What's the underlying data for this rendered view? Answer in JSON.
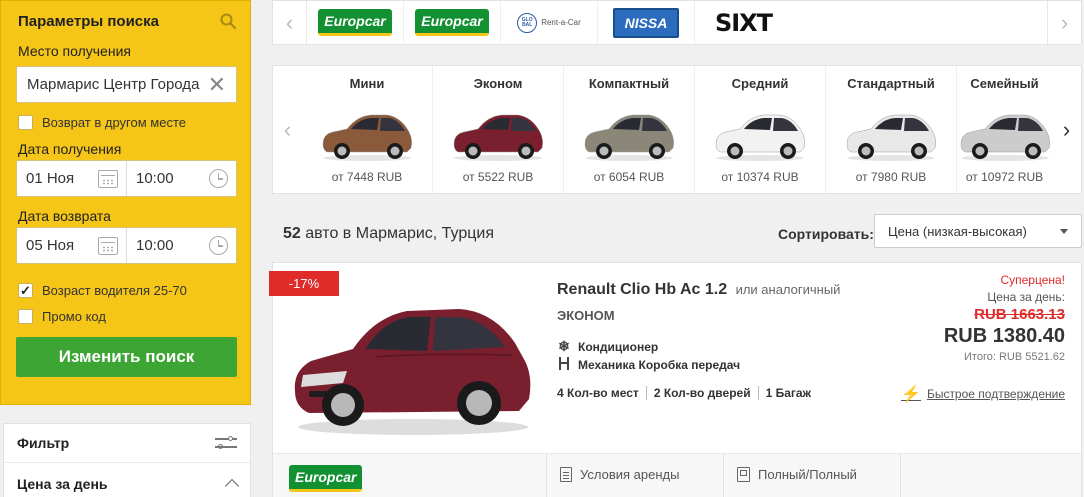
{
  "search": {
    "title": "Параметры поиска",
    "pickup_location_label": "Место получения",
    "pickup_location_value": "Мармарис Центр Города",
    "return_other_label": "Возврат в другом месте",
    "return_other_checked": false,
    "pickup_date_label": "Дата получения",
    "pickup_date": "01 Ноя",
    "pickup_time": "10:00",
    "return_date_label": "Дата возврата",
    "return_date": "05 Ноя",
    "return_time": "10:00",
    "driver_age_label": "Возраст водителя 25-70",
    "driver_age_checked": true,
    "promo_label": "Промо код",
    "promo_checked": false,
    "submit_label": "Изменить поиск",
    "accent_color": "#f5c518",
    "button_color": "#3da534"
  },
  "filter": {
    "title": "Фильтр",
    "section_price": "Цена за день"
  },
  "suppliers": {
    "logos": [
      {
        "name": "Europcar",
        "text": "Europcar"
      },
      {
        "name": "Europcar",
        "text": "Europcar"
      },
      {
        "name": "Global Rent-a-Car",
        "text": "Rent-a-Car",
        "badge": "GLO BAL"
      },
      {
        "name": "Nissa",
        "text": "NISSA"
      },
      {
        "name": "Sixt",
        "text": "SIXT"
      }
    ]
  },
  "categories": [
    {
      "name": "Мини",
      "price": "от 7448 RUB",
      "color": "#8a5a3a"
    },
    {
      "name": "Эконом",
      "price": "от 5522 RUB",
      "color": "#7a1f2e"
    },
    {
      "name": "Компактный",
      "price": "от 6054 RUB",
      "color": "#8a8778"
    },
    {
      "name": "Средний",
      "price": "от 10374 RUB",
      "color": "#f2f2f2"
    },
    {
      "name": "Стандартный",
      "price": "от 7980 RUB",
      "color": "#e8e8e8"
    },
    {
      "name": "Семейный",
      "price": "от 10972 RUB",
      "color": "#cccccc"
    }
  ],
  "results": {
    "count": "52",
    "count_text": "авто в Мармарис, Турция",
    "sort_label": "Сортировать:",
    "sort_value": "Цена (низкая-высокая)"
  },
  "car": {
    "discount": "-17%",
    "model": "Renault Clio Hb Ac 1.2",
    "similar": "или аналогичный",
    "class": "ЭКОНОМ",
    "features": [
      "Кондиционер",
      "Механика Коробка передач"
    ],
    "seats": "4 Кол-во мест",
    "doors": "2 Кол-во дверей",
    "bags": "1 Багаж",
    "super_deal": "Суперцена!",
    "per_day_label": "Цена за день:",
    "old_price": "RUB 1663.13",
    "price": "RUB 1380.40",
    "total": "Итого: RUB 5521.62",
    "fast_confirm": "Быстрое подтверждение",
    "supplier": "Europcar",
    "rental_terms": "Условия аренды",
    "fuel_policy": "Полный/Полный",
    "body_color": "#7a1f2e"
  }
}
